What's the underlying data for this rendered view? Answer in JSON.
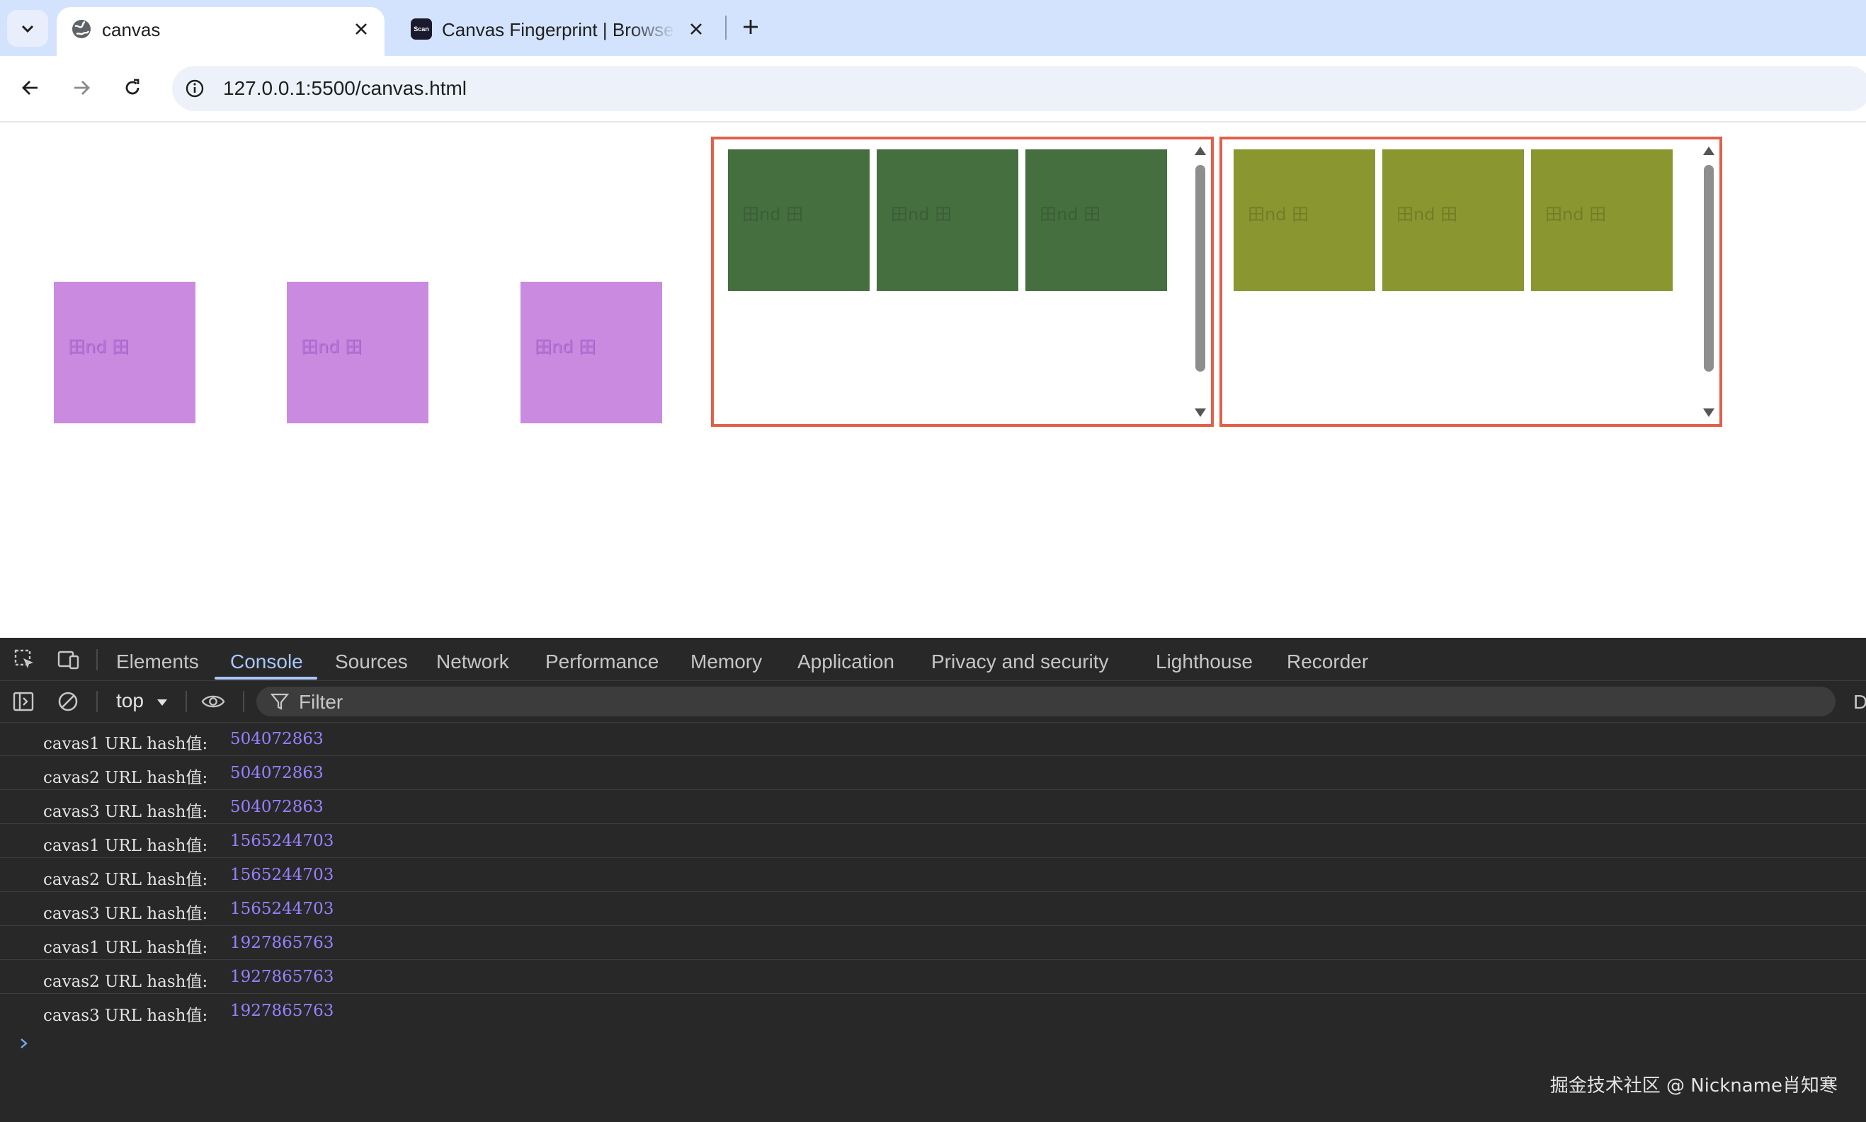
{
  "browser": {
    "tabs": [
      {
        "title": "canvas",
        "active": true,
        "favicon": "globe-icon"
      },
      {
        "title": "Canvas Fingerprint | BrowserScan",
        "active": false,
        "favicon": "scan-icon"
      }
    ],
    "address": "127.0.0.1:5500/canvas.html"
  },
  "page": {
    "fingerprint_text": "田nd 田",
    "colors": {
      "pink": "#c98ae0",
      "green": "#466f40",
      "olive": "#8a9630",
      "frame_border": "#e0604a"
    }
  },
  "devtools": {
    "tabs": [
      "Elements",
      "Console",
      "Sources",
      "Network",
      "Performance",
      "Memory",
      "Application",
      "Privacy and security",
      "Lighthouse",
      "Recorder"
    ],
    "active_tab": "Console",
    "context": "top",
    "filter_placeholder": "Filter",
    "overflow_label": "D",
    "logs": [
      {
        "label": "cavas1 URL hash值:",
        "value": "504072863"
      },
      {
        "label": "cavas2 URL hash值:",
        "value": "504072863"
      },
      {
        "label": "cavas3 URL hash值:",
        "value": "504072863"
      },
      {
        "label": "cavas1 URL hash值:",
        "value": "1565244703"
      },
      {
        "label": "cavas2 URL hash值:",
        "value": "1565244703"
      },
      {
        "label": "cavas3 URL hash值:",
        "value": "1565244703"
      },
      {
        "label": "cavas1 URL hash值:",
        "value": "1927865763"
      },
      {
        "label": "cavas2 URL hash值:",
        "value": "1927865763"
      },
      {
        "label": "cavas3 URL hash值:",
        "value": "1927865763"
      }
    ]
  },
  "watermark": "掘金技术社区 @ Nickname肖知寒"
}
